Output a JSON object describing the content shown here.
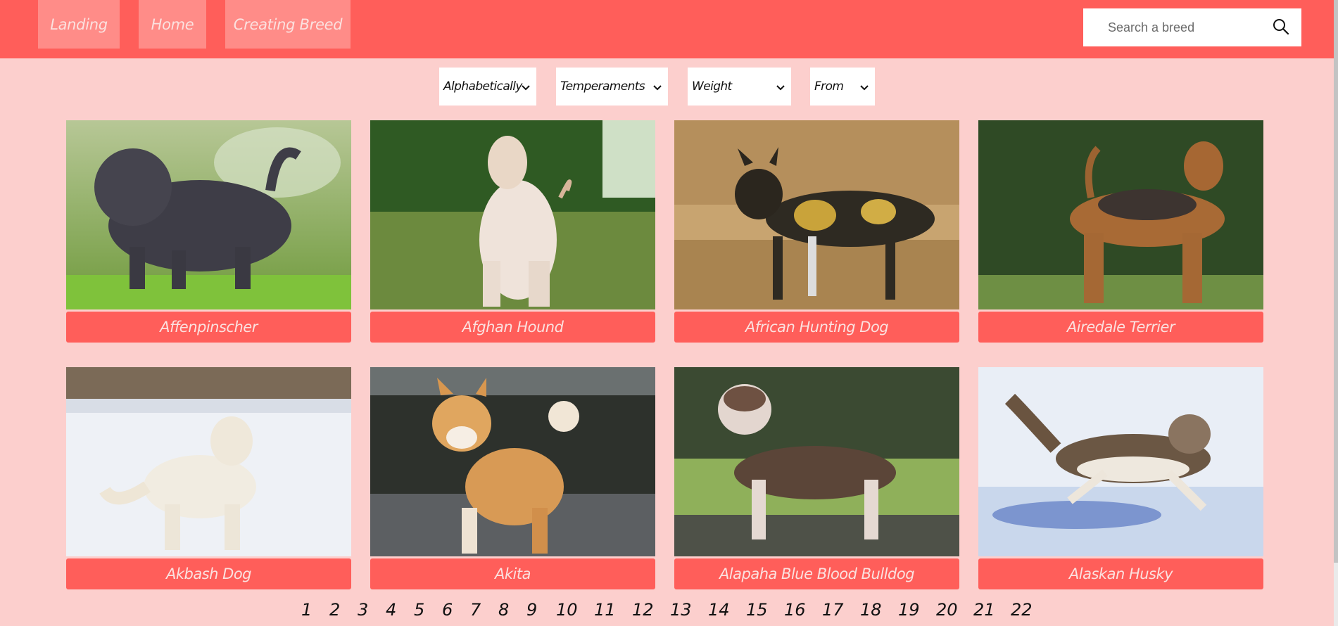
{
  "nav": {
    "links": [
      {
        "label": "Landing"
      },
      {
        "label": "Home"
      },
      {
        "label": "Creating Breed"
      }
    ],
    "search": {
      "placeholder": "Search a breed",
      "icon": "search-icon"
    }
  },
  "filters": [
    {
      "label": "Alphabetically",
      "icon": "chevron-down-icon"
    },
    {
      "label": "Temperaments",
      "icon": "chevron-down-icon"
    },
    {
      "label": "Weight",
      "icon": "chevron-down-icon"
    },
    {
      "label": "From",
      "icon": "chevron-down-icon"
    }
  ],
  "breeds": [
    {
      "name": "Affenpinscher"
    },
    {
      "name": "Afghan Hound"
    },
    {
      "name": "African Hunting Dog"
    },
    {
      "name": "Airedale Terrier"
    },
    {
      "name": "Akbash Dog"
    },
    {
      "name": "Akita"
    },
    {
      "name": "Alapaha Blue Blood Bulldog"
    },
    {
      "name": "Alaskan Husky"
    }
  ],
  "pagination": {
    "pages": [
      "1",
      "2",
      "3",
      "4",
      "5",
      "6",
      "7",
      "8",
      "9",
      "10",
      "11",
      "12",
      "13",
      "14",
      "15",
      "16",
      "17",
      "18",
      "19",
      "20",
      "21",
      "22"
    ]
  },
  "colors": {
    "background": "#fccfcd",
    "accent": "#ff5e5a",
    "nav_button": "#ff8c88",
    "caption_text": "#fbe1df"
  }
}
